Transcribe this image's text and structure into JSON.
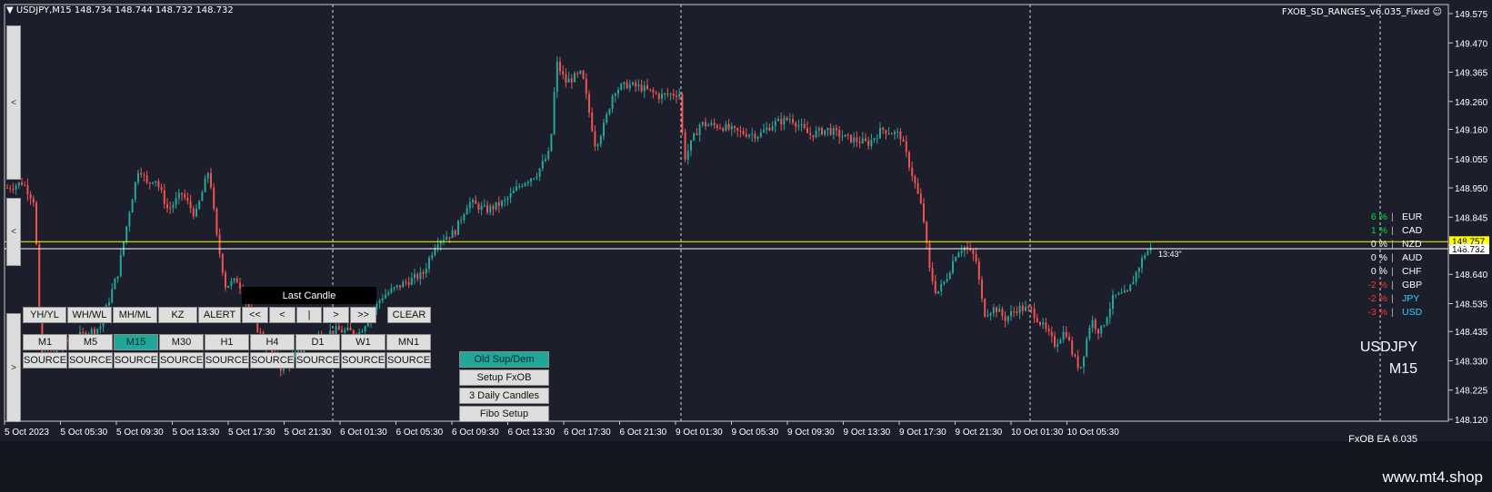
{
  "header": {
    "title": "USDJPY,M15  148.734 148.744 148.732 148.732",
    "ea_name": "FXOB_SD_RANGES_v6.035_Fixed"
  },
  "colors": {
    "background": "#1c1f2b",
    "bull": "#26a69a",
    "bear": "#ef5350",
    "bid_line": "#ffff00",
    "ask_line": "#ffffff",
    "active_button": "#1fa79a"
  },
  "side_tabs": [
    "<",
    "<",
    ">"
  ],
  "toolbar_row1": [
    "YH/YL",
    "WH/WL",
    "MH/ML",
    "KZ",
    "ALERT",
    "<<",
    "<",
    "|",
    ">",
    ">>",
    "CLEAR"
  ],
  "timeframes": [
    "M1",
    "M5",
    "M15",
    "M30",
    "H1",
    "H4",
    "D1",
    "W1",
    "MN1"
  ],
  "active_timeframe": "M15",
  "source_label": "SOURCE",
  "last_candle_label": "Last Candle",
  "setup_buttons": [
    "Old Sup/Dem",
    "Setup FxOB",
    "3 Daily Candles",
    "Fibo Setup"
  ],
  "currency_strength": [
    {
      "pct": "6 %",
      "sep": "|",
      "code": "EUR",
      "color": "#00e040"
    },
    {
      "pct": "1 %",
      "sep": "|",
      "code": "CAD",
      "color": "#00e040"
    },
    {
      "pct": "0 %",
      "sep": "|",
      "code": "NZD",
      "color": "#ffffff"
    },
    {
      "pct": "0 %",
      "sep": "|",
      "code": "AUD",
      "color": "#ffffff"
    },
    {
      "pct": "0 %",
      "sep": "|",
      "code": "CHF",
      "color": "#ffffff"
    },
    {
      "pct": "-2 %",
      "sep": "|",
      "code": "GBP",
      "color": "#ff3333"
    },
    {
      "pct": "-2 %",
      "sep": "|",
      "code": "JPY",
      "color": "#ff3333",
      "code_color": "#2ad4ff"
    },
    {
      "pct": "-3 %",
      "sep": "|",
      "code": "USD",
      "color": "#ff3333",
      "code_color": "#2ad4ff"
    }
  ],
  "symbol": "USDJPY",
  "period": "M15",
  "ea_version": "FxOB EA 6.035",
  "countdown": "13:43\"",
  "price_axis": [
    "149.575",
    "149.470",
    "149.365",
    "149.260",
    "149.160",
    "149.055",
    "148.950",
    "148.845",
    "148.745",
    "148.640",
    "148.535",
    "148.435",
    "148.330",
    "148.225",
    "148.120"
  ],
  "ask_tag": "148.757",
  "bid_tag": "148.732",
  "time_axis": [
    "5 Oct 2023",
    "5 Oct 05:30",
    "5 Oct 09:30",
    "5 Oct 13:30",
    "5 Oct 17:30",
    "5 Oct 21:30",
    "6 Oct 01:30",
    "6 Oct 05:30",
    "6 Oct 09:30",
    "6 Oct 13:30",
    "6 Oct 17:30",
    "6 Oct 21:30",
    "9 Oct 01:30",
    "9 Oct 05:30",
    "9 Oct 09:30",
    "9 Oct 13:30",
    "9 Oct 17:30",
    "9 Oct 21:30",
    "10 Oct 01:30",
    "10 Oct 05:30"
  ],
  "watermark": "www.mt4.shop"
}
